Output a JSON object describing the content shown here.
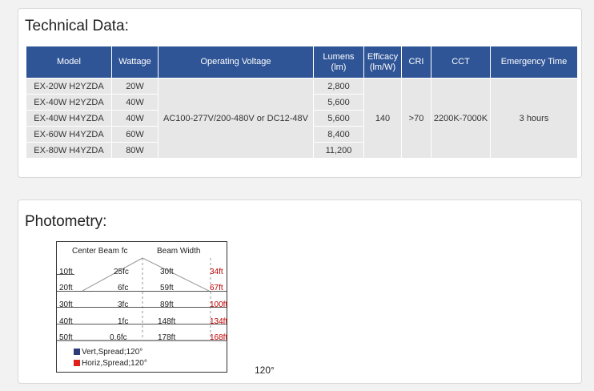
{
  "technical": {
    "title": "Technical Data:",
    "headers": {
      "model": "Model",
      "wattage": "Wattage",
      "voltage": "Operating Voltage",
      "lumens": "Lumens\n(lm)",
      "efficacy": "Efficacy\n(lm/W)",
      "cri": "CRI",
      "cct": "CCT",
      "emergency": "Emergency Time"
    },
    "rows": [
      {
        "model": "EX-20W H2YZDA",
        "wattage": "20W",
        "lumens": "2,800"
      },
      {
        "model": "EX-40W H2YZDA",
        "wattage": "40W",
        "lumens": "5,600"
      },
      {
        "model": "EX-40W H4YZDA",
        "wattage": "40W",
        "lumens": "5,600"
      },
      {
        "model": "EX-60W H4YZDA",
        "wattage": "60W",
        "lumens": "8,400"
      },
      {
        "model": "EX-80W H4YZDA",
        "wattage": "80W",
        "lumens": "11,200"
      }
    ],
    "shared": {
      "voltage": "AC100-277V/200-480V or DC12-48V",
      "efficacy": "140",
      "cri": ">70",
      "cct": "2200K-7000K",
      "emergency": "3 hours"
    }
  },
  "photometry": {
    "title": "Photometry:",
    "center_beam_label": "Center Beam fc",
    "beam_width_label": "Beam Width",
    "rows": [
      {
        "distance": "10ft",
        "fc": "25fc",
        "vert": "30ft",
        "horiz": "34ft"
      },
      {
        "distance": "20ft",
        "fc": "6fc",
        "vert": "59ft",
        "horiz": "67ft"
      },
      {
        "distance": "30ft",
        "fc": "3fc",
        "vert": "89ft",
        "horiz": "100ft"
      },
      {
        "distance": "40ft",
        "fc": "1fc",
        "vert": "148ft",
        "horiz": "134ft"
      },
      {
        "distance": "50ft",
        "fc": "0.6fc",
        "vert": "178ft",
        "horiz": "168ft"
      }
    ],
    "legend": [
      {
        "label": "Vert,Spread;120°",
        "color": "#2e3a7a"
      },
      {
        "label": "Horiz,Spread;120°",
        "color": "#e0201b"
      }
    ],
    "angle": "120°"
  }
}
